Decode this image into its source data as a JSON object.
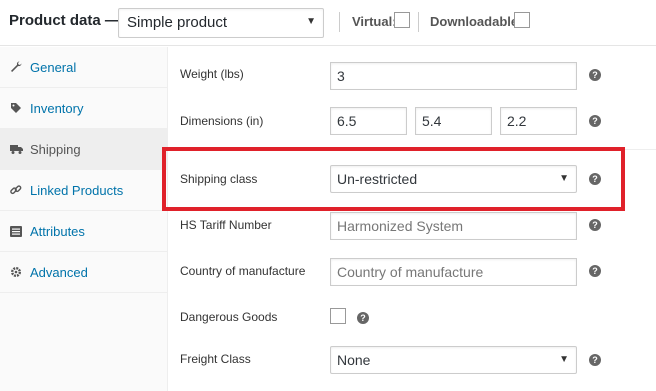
{
  "header": {
    "title": "Product data —",
    "product_type": "Simple product",
    "virtual_label": "Virtual:",
    "downloadable_label": "Downloadable:"
  },
  "sidebar": {
    "items": [
      {
        "label": "General",
        "icon": "wrench-icon"
      },
      {
        "label": "Inventory",
        "icon": "tag-icon"
      },
      {
        "label": "Shipping",
        "icon": "truck-icon",
        "active": true
      },
      {
        "label": "Linked Products",
        "icon": "link-icon"
      },
      {
        "label": "Attributes",
        "icon": "list-icon"
      },
      {
        "label": "Advanced",
        "icon": "gear-icon"
      }
    ]
  },
  "shipping": {
    "weight": {
      "label": "Weight (lbs)",
      "value": "3"
    },
    "dimensions": {
      "label": "Dimensions (in)",
      "length": "6.5",
      "width": "5.4",
      "height": "2.2"
    },
    "shipping_class": {
      "label": "Shipping class",
      "value": "Un-restricted"
    },
    "hs_tariff": {
      "label": "HS Tariff Number",
      "placeholder": "Harmonized System"
    },
    "country": {
      "label": "Country of manufacture",
      "placeholder": "Country of manufacture"
    },
    "dangerous": {
      "label": "Dangerous Goods",
      "checked": false
    },
    "freight": {
      "label": "Freight Class",
      "value": "None"
    }
  },
  "help_glyph": "?",
  "select_arrow": "▼",
  "colors": {
    "link": "#0073aa",
    "highlight": "#e0212a"
  }
}
